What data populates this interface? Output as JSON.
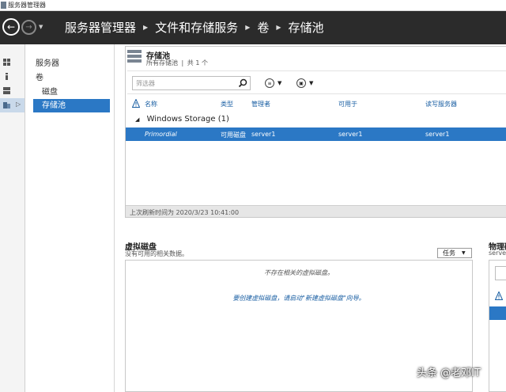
{
  "window": {
    "title": "服务器管理器"
  },
  "header": {
    "breadcrumb": [
      "服务器管理器",
      "文件和存储服务",
      "卷",
      "存储池"
    ]
  },
  "nav": {
    "items": [
      {
        "label": "服务器"
      },
      {
        "label": "卷"
      },
      {
        "label": "磁盘"
      },
      {
        "label": "存储池"
      }
    ]
  },
  "pool": {
    "title": "存储池",
    "subtitle_scope": "所有存储池",
    "subtitle_sep": "|",
    "subtitle_count": "共 1 个",
    "filter_placeholder": "筛选器",
    "columns": [
      "名称",
      "类型",
      "管理者",
      "可用于",
      "读写服务器"
    ],
    "group": {
      "label": "Windows Storage (1)"
    },
    "rows": [
      {
        "name": "Primordial",
        "type": "可用磁盘",
        "managed_by": "server1",
        "available_to": "server1",
        "rw_server": "server1"
      }
    ],
    "status": "上次刷新时间为 2020/3/23 10:41:00"
  },
  "vdisk": {
    "title": "虚拟磁盘",
    "subtitle": "没有可用的相关数据。",
    "tasks_label": "任务",
    "empty_message": "不存在相关的虚拟磁盘。",
    "create_hint": "要创建虚拟磁盘，请启动\"新建虚拟磁盘\"向导。"
  },
  "physical": {
    "title": "物理磁",
    "subtitle": "server"
  },
  "watermark": "头条 @老邓IT",
  "colors": {
    "header_bg": "#2b2b2b",
    "selection": "#2b78c5",
    "link": "#1a5fa3"
  },
  "icons": {
    "back": "back-arrow-icon",
    "forward": "forward-arrow-icon",
    "search": "search-icon",
    "warning": "warning-icon",
    "storage": "storage-pool-icon"
  }
}
